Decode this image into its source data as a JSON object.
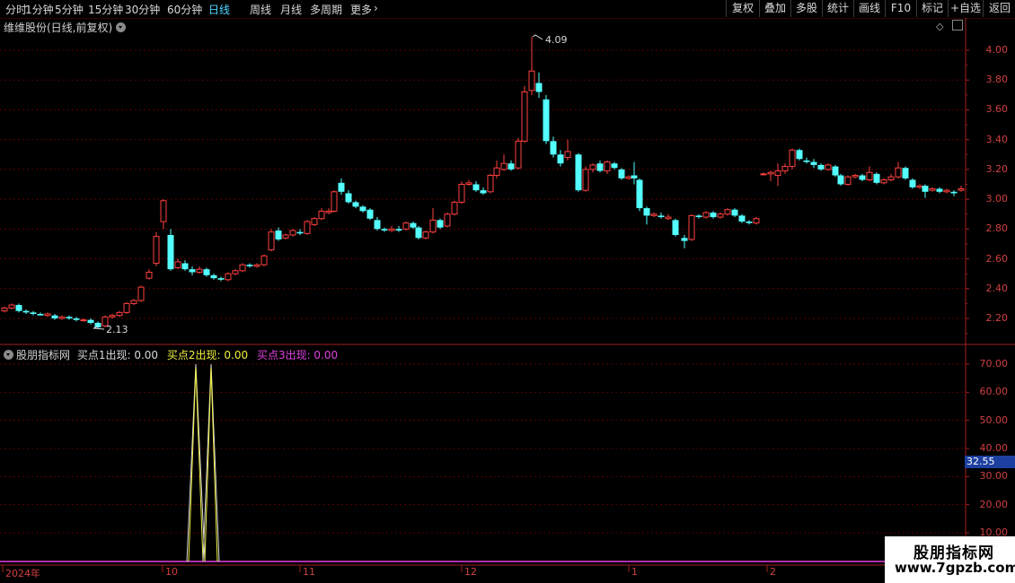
{
  "toolbar": {
    "timeframes": [
      "分时",
      "1分钟",
      "5分钟",
      "15分钟",
      "30分钟",
      "60分钟",
      "日线",
      "周线",
      "月线",
      "多周期",
      "更多"
    ],
    "active_index": 6,
    "right_buttons": [
      "复权",
      "叠加",
      "多股",
      "统计",
      "画线",
      "F10",
      "标记",
      "+自选",
      "返回"
    ]
  },
  "main": {
    "title": "维维股份(日线,前复权)",
    "high_marker": "4.09",
    "low_marker": "2.13",
    "price_labels": [
      "4.00",
      "3.80",
      "3.60",
      "3.40",
      "3.20",
      "3.00",
      "2.80",
      "2.60",
      "2.40",
      "2.20"
    ]
  },
  "indicator": {
    "name": "股朋指标网",
    "buy1": "买点1出现: 0.00",
    "buy2": "买点2出现: 0.00",
    "buy3": "买点3出现: 0.00",
    "axis_labels": [
      "70.00",
      "60.00",
      "50.00",
      "40.00",
      "30.00",
      "20.00",
      "10.00"
    ],
    "current_value": "32.55",
    "colors": {
      "buy1": "#d8d8d8",
      "buy2": "#f0f040",
      "buy3": "#e040e0"
    }
  },
  "dates": [
    "2024年",
    "10",
    "11",
    "12",
    "1",
    "2"
  ],
  "watermark": {
    "line1": "股朋指标网",
    "line2": "www.7gpzb.com"
  },
  "colors": {
    "up": "#ff4040",
    "down": "#54ffff",
    "grid": "#5a0000",
    "axis_text": "#d04040"
  }
}
